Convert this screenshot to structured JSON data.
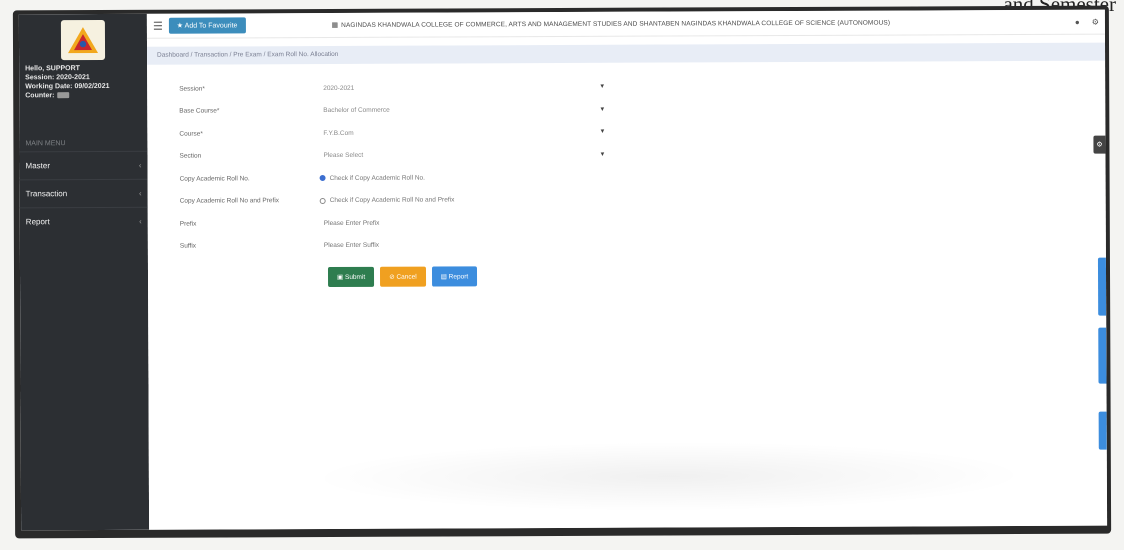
{
  "caption": "and Semester",
  "sidebar": {
    "user": "Hello, SUPPORT",
    "session": "Session: 2020-2021",
    "working_date": "Working Date: 09/02/2021",
    "counter": "Counter:",
    "menu_heading": "MAIN MENU",
    "items": [
      {
        "label": "Master"
      },
      {
        "label": "Transaction"
      },
      {
        "label": "Report"
      }
    ]
  },
  "topbar": {
    "favourite_label": "Add To Favourite",
    "college_name": "NAGINDAS KHANDWALA COLLEGE OF COMMERCE, ARTS AND MANAGEMENT STUDIES AND SHANTABEN NAGINDAS KHANDWALA COLLEGE OF SCIENCE (AUTONOMOUS)"
  },
  "breadcrumb": "Dashboard / Transaction / Pre Exam / Exam Roll No. Allocation",
  "form": {
    "session_label": "Session*",
    "session_value": "2020-2021",
    "base_course_label": "Base Course*",
    "base_course_value": "Bachelor of Commerce",
    "course_label": "Course*",
    "course_value": "F.Y.B.Com",
    "section_label": "Section",
    "section_value": "Please Select",
    "copy_label": "Copy Academic Roll No.",
    "copy_option": "Check if Copy Academic Roll No.",
    "copy_prefix_label": "Copy Academic Roll No and Prefix",
    "copy_prefix_option": "Check if Copy Academic Roll No and Prefix",
    "prefix_label": "Prefix",
    "prefix_placeholder": "Please Enter Prefix",
    "suffix_label": "Suffix",
    "suffix_placeholder": "Please Enter Suffix"
  },
  "buttons": {
    "submit": "Submit",
    "cancel": "Cancel",
    "report": "Report"
  },
  "colors": {
    "sidebar": "#2c2f33",
    "primary": "#3c8dbc",
    "submit": "#2e7d4f",
    "cancel": "#f0a020",
    "report": "#3c8dde"
  }
}
